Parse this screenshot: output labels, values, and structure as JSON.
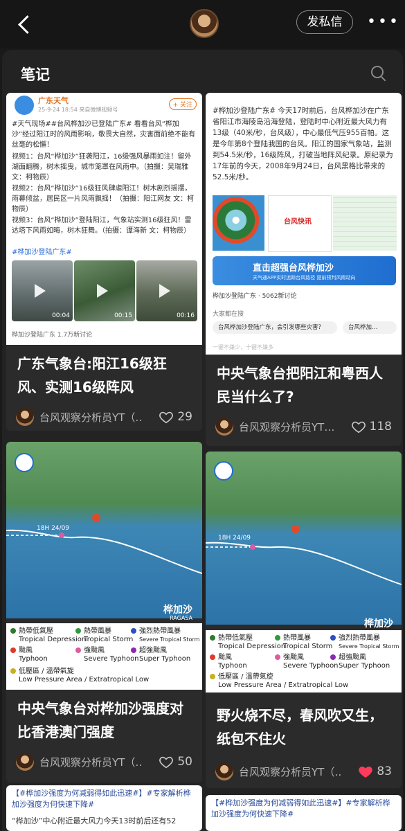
{
  "header": {
    "dm_label": "发私信",
    "more_label": "•••"
  },
  "section_title": "笔记",
  "cards": [
    {
      "title": "广东气象台:阳江16级狂风、实测16级阵风",
      "author": "台风观察分析员YT（…",
      "likes": "29",
      "liked": false,
      "thumb": {
        "account": "广东天气",
        "follow": "+ 关注",
        "meta": "25-9-24 18:54  来自微博视频号",
        "text1": "#天气现场##台风桦加沙已登陆广东# 看看台风“桦加沙”经过阳江时的风雨影响，敬畏大自然，灾害面前绝不能有丝毫的松懈！",
        "text2": "视频1：台风“桦加沙”狂袭阳江，16级强风暴雨如注！留外湖面翻腾，树木摇曳，城市笼罩在风雨中。（拍摄：吴瑞雅 文：柯物辰）",
        "text3": "视频2：台风“桦加沙”16级狂风肆虐阳江！树木剧烈摇摆，雨幕倾盆，居民区一片风雨飘摇！（拍摄：阳江网友 文：柯物辰）",
        "text4": "视频3：台风“桦加沙”登陆阳江，气象站实测16级狂风！雷达塔下风雨如晦，树木狂舞。（拍摄：谭海新 文：柯物辰）",
        "tag": "#桦加沙登陆广东#",
        "v1": "00:04",
        "v2": "00:15",
        "v3": "00:16",
        "footer": "桦加沙登陆广东  1.7万新讨论"
      }
    },
    {
      "title": "中央气象台把阳江和粤西人民当什么了?",
      "author": "台风观察分析员YT…",
      "likes": "118",
      "liked": false,
      "thumb": {
        "text": "#桦加沙登陆广东# 今天17时前后，台风桦加沙在广东省阳江市海陵岛沿海登陆，登陆时中心附近最大风力有13级（40米/秒，台风级），中心最低气压955百帕。这是今年第8个登陆我国的台风。阳江的国家气象站，监测到54.5米/秒，16级阵风，打破当地阵风纪录。原纪录为17年前的今天，2008年9月24日，台风黑格比带来的52.5米/秒。",
        "banner": "台风快讯",
        "ad_title": "直击超强台风桦加沙",
        "ad_sub": "天气通APP实时追踪台风路径  提前预判风雨动向",
        "topic": "桦加沙登陆广东 · 5062新讨论",
        "searching": "大家都在搜",
        "q1": "台风桦加沙登陆广东，会引发哪些灾害？",
        "q2": "台风桦加…",
        "footer": "一键不嫌少，十键不嫌多"
      }
    },
    {
      "title": "中央气象台对桦加沙强度对比香港澳门强度",
      "author": "台风观察分析员YT（…",
      "likes": "50",
      "liked": false
    },
    {
      "title": "野火烧不尽，春风吹又生，纸包不住火",
      "author": "台风观察分析员YT（…",
      "likes": "83",
      "liked": true
    },
    {
      "text": "【#桦加沙强度为何减弱得如此迅速#】#专家解析桦加沙强度为何快速下降#",
      "text2": "“桦加沙”中心附近最大风力今天13时前后还有52"
    },
    {
      "text": "【#桦加沙强度为何减弱得如此迅速#】#专家解析桦加沙强度为何快速下降#"
    }
  ],
  "map": {
    "time": "18H 24/09",
    "name": "桦加沙",
    "name_en": "RAGASA",
    "legend": [
      {
        "zh": "熱帶低氣壓",
        "en": "Tropical Depression",
        "color": "#2d7a2d"
      },
      {
        "zh": "熱帶風暴",
        "en": "Tropical Storm",
        "color": "#2f9a3a"
      },
      {
        "zh": "強烈熱帶風暴",
        "en": "Severe Tropical Storm",
        "color": "#2f4fc0"
      },
      {
        "zh": "颱風",
        "en": "Typhoon",
        "color": "#e03a2a"
      },
      {
        "zh": "強颱風",
        "en": "Severe Typhoon",
        "color": "#e05aa0"
      },
      {
        "zh": "超強颱風",
        "en": "Super Typhoon",
        "color": "#8a2ab0"
      },
      {
        "zh": "低壓區 / 溫帶氣旋",
        "en": "Low Pressure Area / Extratropical Low",
        "color": "#c8b020"
      }
    ]
  },
  "colors": {
    "accent_heart": "#ff3b5c",
    "background": "#1a1a1a",
    "card": "#2b2b2b"
  }
}
